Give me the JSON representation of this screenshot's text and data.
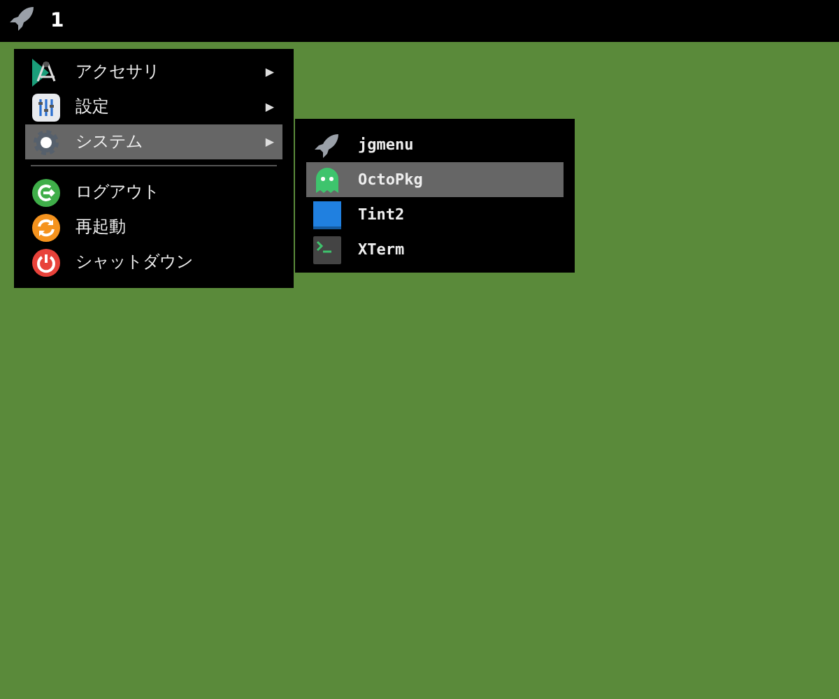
{
  "panel": {
    "workspace": "1"
  },
  "menu": {
    "items": [
      {
        "kind": "item",
        "label": "アクセサリ",
        "arrow": "▶",
        "selected": false
      },
      {
        "kind": "item",
        "label": "設定",
        "arrow": "▶",
        "selected": false
      },
      {
        "kind": "item",
        "label": "システム",
        "arrow": "▶",
        "selected": true
      },
      {
        "kind": "separator"
      },
      {
        "kind": "item",
        "label": "ログアウト",
        "selected": false
      },
      {
        "kind": "item",
        "label": "再起動",
        "selected": false
      },
      {
        "kind": "item",
        "label": "シャットダウン",
        "selected": false
      }
    ]
  },
  "submenu": {
    "items": [
      {
        "kind": "item",
        "label": "jgmenu",
        "selected": false
      },
      {
        "kind": "item",
        "label": "OctoPkg",
        "selected": true
      },
      {
        "kind": "item",
        "label": "Tint2",
        "selected": false
      },
      {
        "kind": "item",
        "label": "XTerm",
        "selected": false
      }
    ]
  }
}
